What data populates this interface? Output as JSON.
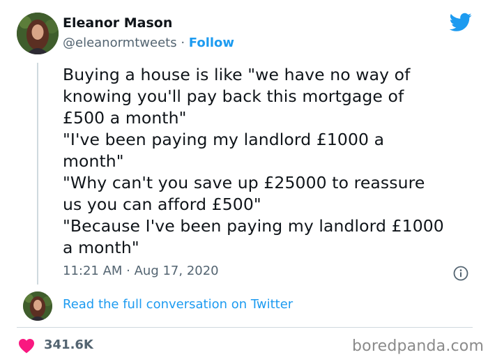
{
  "author": {
    "display_name": "Eleanor Mason",
    "handle": "@eleanormtweets",
    "separator": " · ",
    "follow_label": "Follow"
  },
  "tweet": {
    "text": "Buying a house is like \"we have no way of\nknowing you'll pay back this mortgage of\n£500 a month\"\n\"I've been paying my landlord £1000 a\nmonth\"\n\"Why can't you save up £25000 to reassure\nus you can afford £500\"\n\"Because I've been paying my landlord £1000\na month\"",
    "timestamp": "11:21 AM · Aug 17, 2020"
  },
  "conversation_link": "Read the full conversation on Twitter",
  "likes": "341.6K",
  "watermark": "boredpanda.com",
  "icons": {
    "brand": "twitter-bird-icon",
    "info": "info-icon",
    "like": "heart-icon"
  },
  "colors": {
    "accent": "#1d9bf0",
    "heart": "#f91880",
    "muted": "#536471",
    "text": "#0f1419"
  }
}
